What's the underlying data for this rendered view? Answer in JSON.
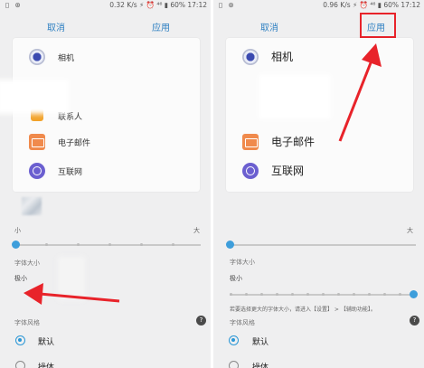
{
  "left": {
    "status": {
      "left_icons": "▯ ⊛",
      "right_text": "0.32 K/s ⚡ ⏰ ⁴⁶ ▮ 60% 17:12"
    },
    "topbar": {
      "cancel": "取消",
      "apply": "应用"
    },
    "apps": [
      {
        "label": "相机",
        "icon": "camera-icon"
      },
      {
        "label": "联系人",
        "icon": "contacts-icon"
      },
      {
        "label": "电子邮件",
        "icon": "email-icon"
      },
      {
        "label": "互联网",
        "icon": "internet-icon"
      }
    ],
    "zoom": {
      "min": "小",
      "max": "大"
    },
    "font_size": {
      "title": "字体大小",
      "value": "极小"
    },
    "font_style": {
      "title": "字体风格",
      "options": [
        {
          "label": "默认",
          "selected": true
        },
        {
          "label": "操体",
          "selected": false
        }
      ]
    }
  },
  "right": {
    "status": {
      "left_icons": "▯ ⊛",
      "right_text": "0.96 K/s ⚡ ⏰ ⁴⁶ ▮ 60% 17:12"
    },
    "topbar": {
      "cancel": "取消",
      "apply": "应用"
    },
    "apps": [
      {
        "label": "相机",
        "icon": "camera-icon"
      },
      {
        "label": "电子邮件",
        "icon": "email-icon"
      },
      {
        "label": "互联网",
        "icon": "internet-icon"
      }
    ],
    "zoom": {
      "max": "大"
    },
    "font_size": {
      "title": "字体大小",
      "value": "极小",
      "hint": "若要选择更大的字体大小，请进入【设置】 > 【辅助功能】。"
    },
    "font_style": {
      "title": "字体风格",
      "options": [
        {
          "label": "默认",
          "selected": true
        },
        {
          "label": "操体",
          "selected": false
        }
      ]
    }
  },
  "colors": {
    "accent": "#2f80c2",
    "slider": "#3e9edb",
    "annotation": "#e8232a"
  }
}
